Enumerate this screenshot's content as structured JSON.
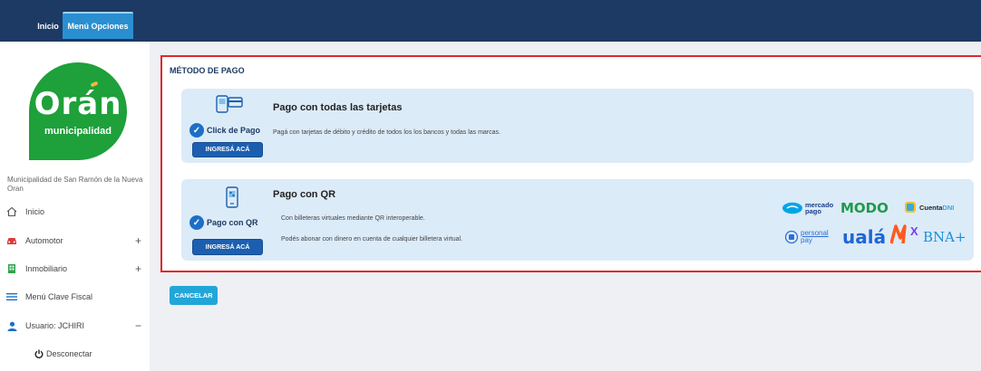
{
  "topbar": {
    "tabs": [
      {
        "label": "Inicio"
      },
      {
        "label": "Menú Opciones"
      }
    ]
  },
  "sidebar": {
    "logo": {
      "title": "Orán",
      "subtitle": "municipalidad"
    },
    "municipality_name": "Municipalidad de San Ramón de la Nueva Oran",
    "items": [
      {
        "label": "Inicio",
        "icon": "home-icon"
      },
      {
        "label": "Automotor",
        "icon": "car-icon",
        "toggle": "+"
      },
      {
        "label": "Inmobiliario",
        "icon": "building-icon",
        "toggle": "+"
      },
      {
        "label": "Menú Clave Fiscal",
        "icon": "menu-icon"
      },
      {
        "label": "Usuario: JCHIRI",
        "icon": "user-icon",
        "toggle": "−"
      }
    ],
    "disconnect_label": "Desconectar"
  },
  "main": {
    "section_title": "MÉTODO DE PAGO",
    "card1": {
      "title": "Pago con todas las tarjetas",
      "badge": "Click de Pago",
      "description": "Pagá con tarjetas de débito y crédito de todos los los bancos y todas las marcas.",
      "button": "INGRESÁ ACÁ"
    },
    "card2": {
      "title": "Pago con QR",
      "badge": "Pago con QR",
      "description1": "Con billeteras virtuales mediante QR interoperable.",
      "description2": "Podés abonar con dinero en cuenta de cualquier billetera virtual.",
      "button": "INGRESÁ ACÁ",
      "brands": {
        "mercadopago_line1": "mercado",
        "mercadopago_line2": "pago",
        "modo": "MODO",
        "cuentadni_a": "Cuenta",
        "cuentadni_b": "DNI",
        "personalpay_line1": "personal",
        "personalpay_line2": "pay",
        "uala": "ualá",
        "naranjax": "X",
        "bna": "BNA+"
      }
    },
    "cancel_button": "CANCELAR"
  },
  "colors": {
    "topbar": "#1c3a64",
    "active_tab": "#2a8fd0",
    "logo_green": "#1ea03a",
    "card_bg": "#dcebf8",
    "panel_border": "#e0262b",
    "primary_button": "#1c5fb0",
    "cancel_button": "#22a6d8"
  }
}
